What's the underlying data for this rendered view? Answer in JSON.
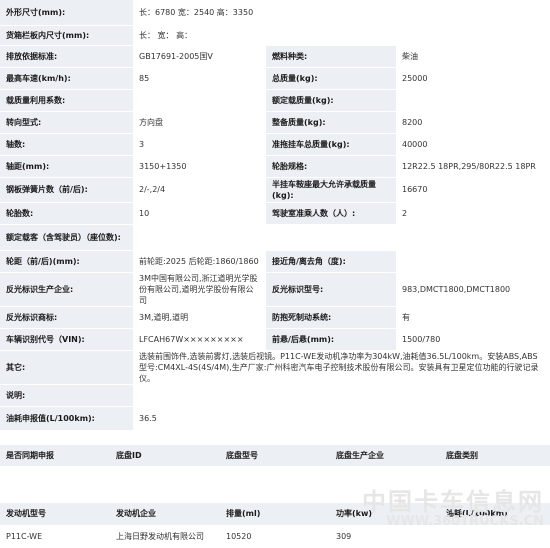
{
  "spec": {
    "dims_label": "外形尺寸(mm):",
    "dims_value": "长：6780 宽：2540 高：3350",
    "cargo_label": "货箱栏板内尺寸(mm):",
    "cargo_value": "长： 宽： 高：",
    "emission_label": "排放依据标准:",
    "emission_value": "GB17691-2005国V",
    "fuel_label": "燃料种类:",
    "fuel_value": "柴油",
    "speed_label": "最高车速(km/h):",
    "speed_value": "85",
    "total_mass_label": "总质量(kg):",
    "total_mass_value": "25000",
    "load_util_label": "载质量利用系数:",
    "load_util_value": "",
    "rated_load_label": "额定载质量(kg):",
    "rated_load_value": "",
    "steering_label": "转向型式:",
    "steering_value": "方向盘",
    "curb_label": "整备质量(kg):",
    "curb_value": "8200",
    "axles_label": "轴数:",
    "axles_value": "3",
    "tow_label": "准拖挂车总质量(kg):",
    "tow_value": "40000",
    "wheelbase_label": "轴距(mm):",
    "wheelbase_value": "3150+1350",
    "tire_label": "轮胎规格:",
    "tire_value": "12R22.5 18PR,295/80R22.5 18PR",
    "springs_label": "钢板弹簧片数（前/后):",
    "springs_value": "2/-,2/4",
    "saddle_label": "半挂车鞍座最大允许承载质量(kg):",
    "saddle_value": "16670",
    "tires_count_label": "轮胎数:",
    "tires_count_value": "10",
    "cab_label": "驾驶室准乘人数（人）:",
    "cab_value": "2",
    "passengers_label": "额定载客（含驾驶员）（座位数):",
    "passengers_value": "",
    "track_label": "轮距（前/后)(mm):",
    "track_value": "前轮距:2025 后轮距:1860/1860",
    "angle_label": "接近角/离去角（度):",
    "angle_value": "",
    "reflect_co_label": "反光标识生产企业:",
    "reflect_co_value": "3M中国有限公司,浙江道明光学股份有限公司,道明光学股份有限公司",
    "reflect_model_label": "反光标识型号:",
    "reflect_model_value": "983,DMCT1800,DMCT1800",
    "reflect_brand_label": "反光标识商标:",
    "reflect_brand_value": "3M,道明,道明",
    "abs_label": "防抱死制动系统:",
    "abs_value": "有",
    "vin_label": "车辆识别代号（VIN):",
    "vin_value": "LFCAH67W×××××××××",
    "overhang_label": "前悬/后悬(mm):",
    "overhang_value": "1500/780",
    "other_label": "其它:",
    "other_value": "选装前围饰件,选装前雾灯,选装后视镜。P11C-WE发动机净功率为304kW,油耗值36.5L/100km。安装ABS,ABS型号:CM4XL-4S(4S/4M),生产厂家:广州科密汽车电子控制技术股份有限公司。安装具有卫星定位功能的行驶记录仪。",
    "note_label": "说明:",
    "note_value": "",
    "fuel_cons_label": "油耗申报值(L/100km):",
    "fuel_cons_value": "36.5"
  },
  "chassis": {
    "headers": [
      "是否同期申报",
      "底盘ID",
      "底盘型号",
      "底盘生产企业",
      "底盘类别"
    ],
    "row": [
      "",
      "",
      "",
      "",
      ""
    ]
  },
  "engine": {
    "headers": [
      "发动机型号",
      "发动机企业",
      "排量(ml)",
      "功率(kw)",
      "油耗(L/100km)"
    ],
    "row": [
      "P11C-WE",
      "上海日野发动机有限公司",
      "10520",
      "309",
      ""
    ]
  },
  "watermark": {
    "cn": "中国卡车信息网",
    "en": "WWW.360TRUCKS.CN"
  }
}
